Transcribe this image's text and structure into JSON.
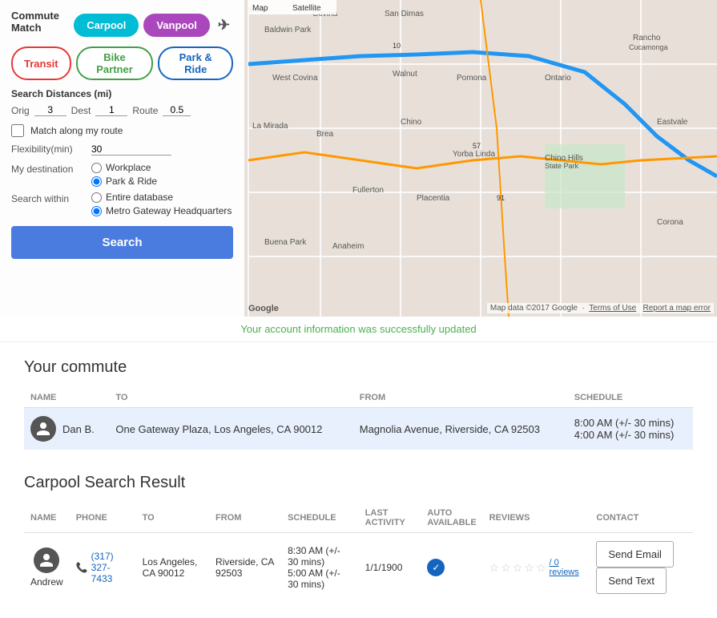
{
  "map": {
    "tab_map": "Map",
    "tab_satellite": "Satellite",
    "attribution": "Map data ©2017 Google",
    "terms": "Terms of Use",
    "report": "Report a map error",
    "google_logo": "Google"
  },
  "sidebar": {
    "commute_match_label": "Commute Match",
    "btn_carpool": "Carpool",
    "btn_vanpool": "Vanpool",
    "btn_transit": "Transit",
    "btn_bike_partner": "Bike Partner",
    "btn_park_ride": "Park & Ride",
    "search_distances_label": "Search Distances (mi)",
    "orig_label": "Orig",
    "orig_value": "3",
    "dest_label": "Dest",
    "dest_value": "1",
    "route_label": "Route",
    "route_value": "0.5",
    "match_route_label": "Match along my route",
    "flexibility_label": "Flexibility(min)",
    "flexibility_value": "30",
    "my_destination_label": "My destination",
    "dest_options": [
      {
        "label": "Workplace",
        "selected": false
      },
      {
        "label": "Park & Ride",
        "selected": true
      }
    ],
    "search_within_label": "Search within",
    "search_within_options": [
      {
        "label": "Entire database",
        "selected": false
      },
      {
        "label": "Metro Gateway Headquarters",
        "selected": true
      }
    ],
    "search_btn": "Search"
  },
  "success_message": "Your account information was successfully updated",
  "your_commute": {
    "title": "Your commute",
    "columns": [
      "NAME",
      "TO",
      "FROM",
      "SCHEDULE"
    ],
    "rows": [
      {
        "name": "Dan B.",
        "to": "One Gateway Plaza, Los Angeles, CA 90012",
        "from": "Magnolia Avenue, Riverside, CA 92503",
        "schedule_line1": "8:00 AM (+/- 30 mins)",
        "schedule_line2": "4:00 AM (+/- 30 mins)"
      }
    ]
  },
  "carpool_search": {
    "title": "Carpool Search Result",
    "columns": [
      "NAME",
      "PHONE",
      "TO",
      "FROM",
      "SCHEDULE",
      "LAST ACTIVITY",
      "AUTO AVAILABLE",
      "REVIEWS",
      "CONTACT"
    ],
    "rows": [
      {
        "name": "Andrew",
        "phone": "(317) 327-7433",
        "to": "Los Angeles, CA 90012",
        "from": "Riverside, CA 92503",
        "schedule_line1": "8:30 AM (+/- 30 mins)",
        "schedule_line2": "5:00 AM (+/- 30 mins)",
        "last_activity": "1/1/1900",
        "auto_available": true,
        "reviews_count": "/ 0 reviews",
        "btn_email": "Send Email",
        "btn_text": "Send Text"
      }
    ]
  }
}
